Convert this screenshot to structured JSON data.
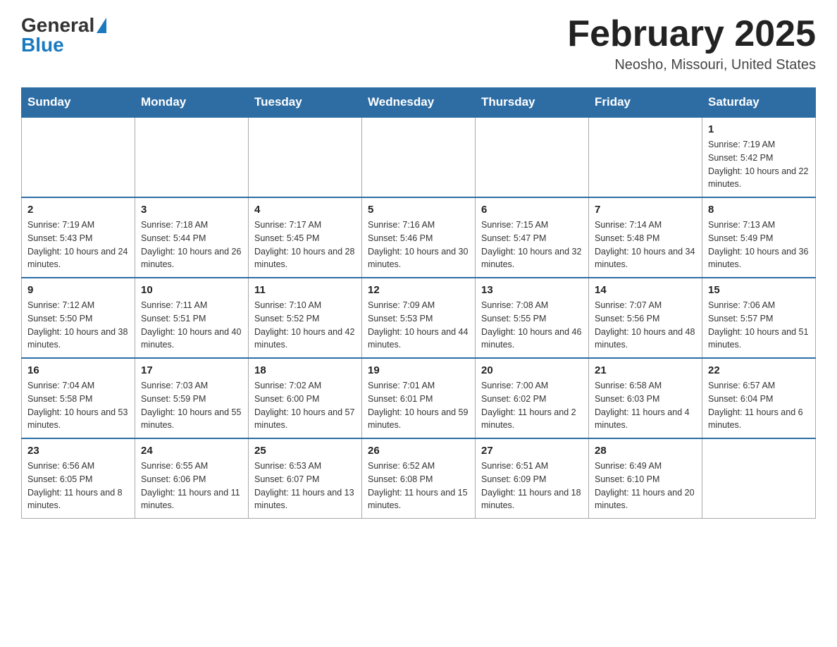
{
  "header": {
    "logo_general": "General",
    "logo_blue": "Blue",
    "month_title": "February 2025",
    "location": "Neosho, Missouri, United States"
  },
  "days_of_week": [
    "Sunday",
    "Monday",
    "Tuesday",
    "Wednesday",
    "Thursday",
    "Friday",
    "Saturday"
  ],
  "weeks": [
    [
      {
        "day": "",
        "info": ""
      },
      {
        "day": "",
        "info": ""
      },
      {
        "day": "",
        "info": ""
      },
      {
        "day": "",
        "info": ""
      },
      {
        "day": "",
        "info": ""
      },
      {
        "day": "",
        "info": ""
      },
      {
        "day": "1",
        "info": "Sunrise: 7:19 AM\nSunset: 5:42 PM\nDaylight: 10 hours and 22 minutes."
      }
    ],
    [
      {
        "day": "2",
        "info": "Sunrise: 7:19 AM\nSunset: 5:43 PM\nDaylight: 10 hours and 24 minutes."
      },
      {
        "day": "3",
        "info": "Sunrise: 7:18 AM\nSunset: 5:44 PM\nDaylight: 10 hours and 26 minutes."
      },
      {
        "day": "4",
        "info": "Sunrise: 7:17 AM\nSunset: 5:45 PM\nDaylight: 10 hours and 28 minutes."
      },
      {
        "day": "5",
        "info": "Sunrise: 7:16 AM\nSunset: 5:46 PM\nDaylight: 10 hours and 30 minutes."
      },
      {
        "day": "6",
        "info": "Sunrise: 7:15 AM\nSunset: 5:47 PM\nDaylight: 10 hours and 32 minutes."
      },
      {
        "day": "7",
        "info": "Sunrise: 7:14 AM\nSunset: 5:48 PM\nDaylight: 10 hours and 34 minutes."
      },
      {
        "day": "8",
        "info": "Sunrise: 7:13 AM\nSunset: 5:49 PM\nDaylight: 10 hours and 36 minutes."
      }
    ],
    [
      {
        "day": "9",
        "info": "Sunrise: 7:12 AM\nSunset: 5:50 PM\nDaylight: 10 hours and 38 minutes."
      },
      {
        "day": "10",
        "info": "Sunrise: 7:11 AM\nSunset: 5:51 PM\nDaylight: 10 hours and 40 minutes."
      },
      {
        "day": "11",
        "info": "Sunrise: 7:10 AM\nSunset: 5:52 PM\nDaylight: 10 hours and 42 minutes."
      },
      {
        "day": "12",
        "info": "Sunrise: 7:09 AM\nSunset: 5:53 PM\nDaylight: 10 hours and 44 minutes."
      },
      {
        "day": "13",
        "info": "Sunrise: 7:08 AM\nSunset: 5:55 PM\nDaylight: 10 hours and 46 minutes."
      },
      {
        "day": "14",
        "info": "Sunrise: 7:07 AM\nSunset: 5:56 PM\nDaylight: 10 hours and 48 minutes."
      },
      {
        "day": "15",
        "info": "Sunrise: 7:06 AM\nSunset: 5:57 PM\nDaylight: 10 hours and 51 minutes."
      }
    ],
    [
      {
        "day": "16",
        "info": "Sunrise: 7:04 AM\nSunset: 5:58 PM\nDaylight: 10 hours and 53 minutes."
      },
      {
        "day": "17",
        "info": "Sunrise: 7:03 AM\nSunset: 5:59 PM\nDaylight: 10 hours and 55 minutes."
      },
      {
        "day": "18",
        "info": "Sunrise: 7:02 AM\nSunset: 6:00 PM\nDaylight: 10 hours and 57 minutes."
      },
      {
        "day": "19",
        "info": "Sunrise: 7:01 AM\nSunset: 6:01 PM\nDaylight: 10 hours and 59 minutes."
      },
      {
        "day": "20",
        "info": "Sunrise: 7:00 AM\nSunset: 6:02 PM\nDaylight: 11 hours and 2 minutes."
      },
      {
        "day": "21",
        "info": "Sunrise: 6:58 AM\nSunset: 6:03 PM\nDaylight: 11 hours and 4 minutes."
      },
      {
        "day": "22",
        "info": "Sunrise: 6:57 AM\nSunset: 6:04 PM\nDaylight: 11 hours and 6 minutes."
      }
    ],
    [
      {
        "day": "23",
        "info": "Sunrise: 6:56 AM\nSunset: 6:05 PM\nDaylight: 11 hours and 8 minutes."
      },
      {
        "day": "24",
        "info": "Sunrise: 6:55 AM\nSunset: 6:06 PM\nDaylight: 11 hours and 11 minutes."
      },
      {
        "day": "25",
        "info": "Sunrise: 6:53 AM\nSunset: 6:07 PM\nDaylight: 11 hours and 13 minutes."
      },
      {
        "day": "26",
        "info": "Sunrise: 6:52 AM\nSunset: 6:08 PM\nDaylight: 11 hours and 15 minutes."
      },
      {
        "day": "27",
        "info": "Sunrise: 6:51 AM\nSunset: 6:09 PM\nDaylight: 11 hours and 18 minutes."
      },
      {
        "day": "28",
        "info": "Sunrise: 6:49 AM\nSunset: 6:10 PM\nDaylight: 11 hours and 20 minutes."
      },
      {
        "day": "",
        "info": ""
      }
    ]
  ]
}
